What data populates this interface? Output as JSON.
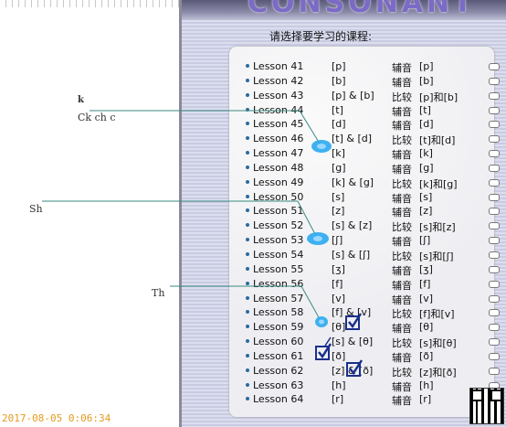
{
  "notes": {
    "k": "k",
    "ck": "Ck  ch  c",
    "sh": "Sh",
    "th": "Th"
  },
  "app": {
    "banner_text": "CONSONANT 辅音",
    "prompt": "请选择要学习的课程:",
    "lessons": [
      {
        "lesson": "Lesson 41",
        "ipa": "[p]",
        "kind": "辅音",
        "val": "[p]"
      },
      {
        "lesson": "Lesson 42",
        "ipa": "[b]",
        "kind": "辅音",
        "val": "[b]"
      },
      {
        "lesson": "Lesson 43",
        "ipa": "[p] & [b]",
        "kind": "比较",
        "val": "[p]和[b]"
      },
      {
        "lesson": "Lesson 44",
        "ipa": "[t]",
        "kind": "辅音",
        "val": "[t]"
      },
      {
        "lesson": "Lesson 45",
        "ipa": "[d]",
        "kind": "辅音",
        "val": "[d]"
      },
      {
        "lesson": "Lesson 46",
        "ipa": "[t] & [d]",
        "kind": "比较",
        "val": "[t]和[d]"
      },
      {
        "lesson": "Lesson 47",
        "ipa": "[k]",
        "kind": "辅音",
        "val": "[k]"
      },
      {
        "lesson": "Lesson 48",
        "ipa": "[g]",
        "kind": "辅音",
        "val": "[g]"
      },
      {
        "lesson": "Lesson 49",
        "ipa": "[k] & [g]",
        "kind": "比较",
        "val": "[k]和[g]"
      },
      {
        "lesson": "Lesson 50",
        "ipa": "[s]",
        "kind": "辅音",
        "val": "[s]"
      },
      {
        "lesson": "Lesson 51",
        "ipa": "[z]",
        "kind": "辅音",
        "val": "[z]"
      },
      {
        "lesson": "Lesson 52",
        "ipa": "[s] & [z]",
        "kind": "比较",
        "val": "[s]和[z]"
      },
      {
        "lesson": "Lesson 53",
        "ipa": "[ʃ]",
        "kind": "辅音",
        "val": "[ʃ]"
      },
      {
        "lesson": "Lesson 54",
        "ipa": "[s] & [ʃ]",
        "kind": "比较",
        "val": "[s]和[ʃ]"
      },
      {
        "lesson": "Lesson 55",
        "ipa": "[ʒ]",
        "kind": "辅音",
        "val": "[ʒ]"
      },
      {
        "lesson": "Lesson 56",
        "ipa": "[f]",
        "kind": "辅音",
        "val": "[f]"
      },
      {
        "lesson": "Lesson 57",
        "ipa": "[v]",
        "kind": "辅音",
        "val": "[v]"
      },
      {
        "lesson": "Lesson 58",
        "ipa": "[f] & [v]",
        "kind": "比较",
        "val": "[f]和[v]"
      },
      {
        "lesson": "Lesson 59",
        "ipa": "[θ]",
        "kind": "辅音",
        "val": "[θ]"
      },
      {
        "lesson": "Lesson 60",
        "ipa": "[s] & [θ]",
        "kind": "比较",
        "val": "[s]和[θ]"
      },
      {
        "lesson": "Lesson 61",
        "ipa": "[ð]",
        "kind": "辅音",
        "val": "[ð]"
      },
      {
        "lesson": "Lesson 62",
        "ipa": "[z] & [ð]",
        "kind": "比较",
        "val": "[z]和[ð]"
      },
      {
        "lesson": "Lesson 63",
        "ipa": "[h]",
        "kind": "辅音",
        "val": "[h]"
      },
      {
        "lesson": "Lesson 64",
        "ipa": "[r]",
        "kind": "辅音",
        "val": "[r]"
      }
    ]
  },
  "colors": {
    "accent_blue": "#2aa8f0",
    "check_blue": "#1a2f8a",
    "annotation_line": "#3a8a80",
    "timestamp": "#e39a1e"
  },
  "timestamp": "2017-08-05  0:06:34"
}
